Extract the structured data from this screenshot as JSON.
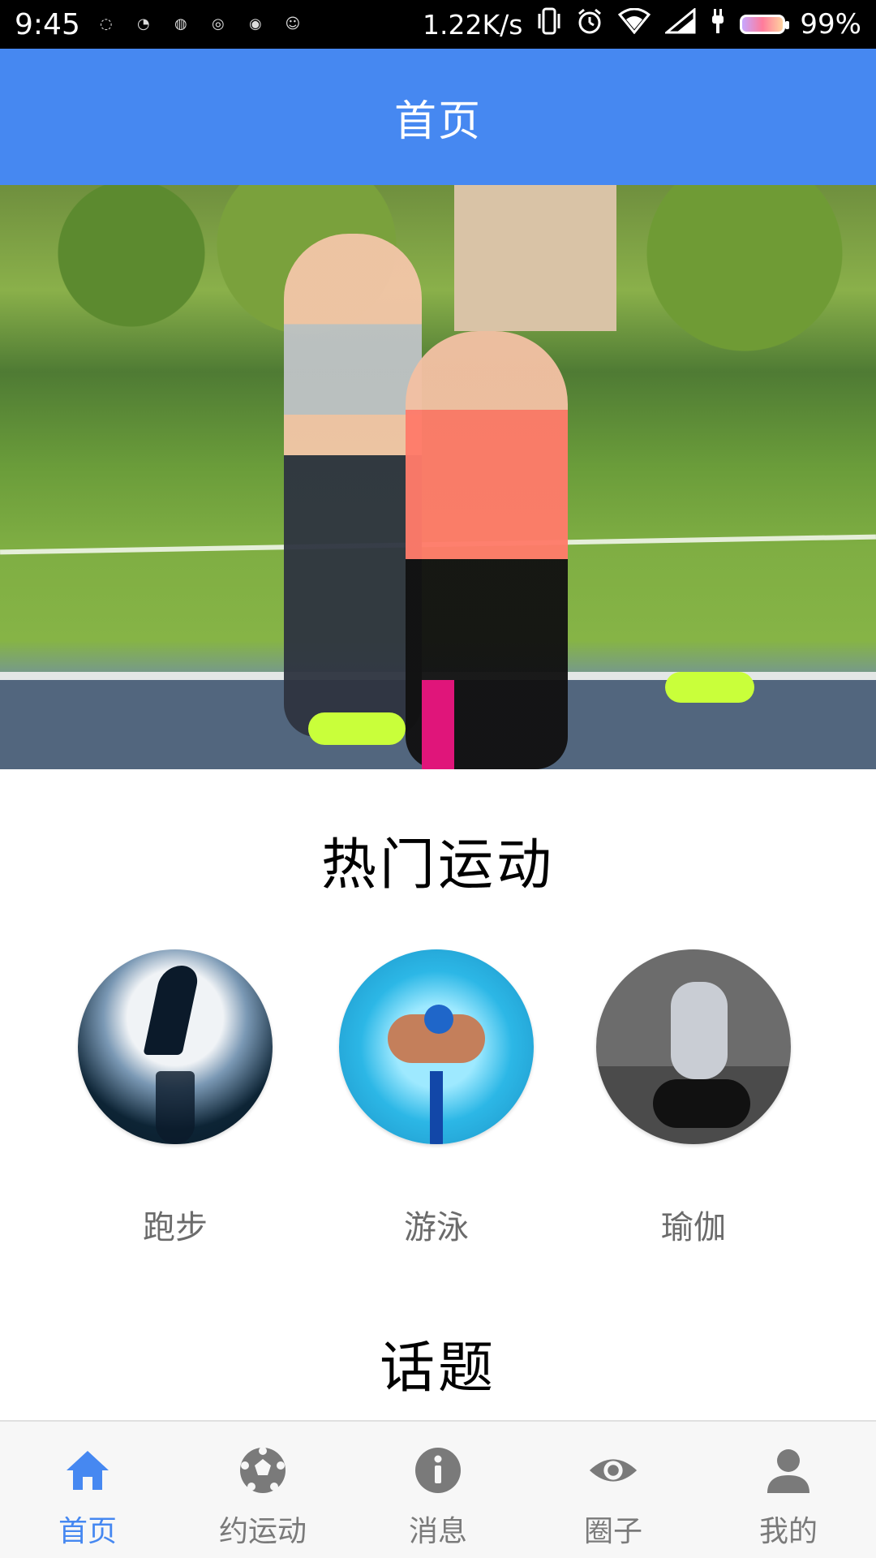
{
  "status_bar": {
    "time": "9:45",
    "net_speed": "1.22K/s",
    "battery": "99%",
    "icons": [
      "notification-icons",
      "vibrate-icon",
      "alarm-icon",
      "wifi-icon",
      "signal-icon",
      "charging-icon",
      "battery-icon"
    ]
  },
  "app_bar": {
    "title": "首页",
    "color": "#4688f1"
  },
  "banner": {
    "page_indicator": {
      "current": 1
    }
  },
  "hot_sports": {
    "title": "热门运动",
    "items": [
      {
        "label": "跑步"
      },
      {
        "label": "游泳"
      },
      {
        "label": "瑜伽"
      }
    ]
  },
  "topics": {
    "title": "话题"
  },
  "bottom_nav": {
    "active_color": "#4688f1",
    "inactive_color": "#7a7a7a",
    "items": [
      {
        "label": "首页",
        "icon": "home-icon",
        "active": true
      },
      {
        "label": "约运动",
        "icon": "soccer-ball-icon",
        "active": false
      },
      {
        "label": "消息",
        "icon": "info-icon",
        "active": false
      },
      {
        "label": "圈子",
        "icon": "eye-icon",
        "active": false
      },
      {
        "label": "我的",
        "icon": "person-icon",
        "active": false
      }
    ]
  }
}
